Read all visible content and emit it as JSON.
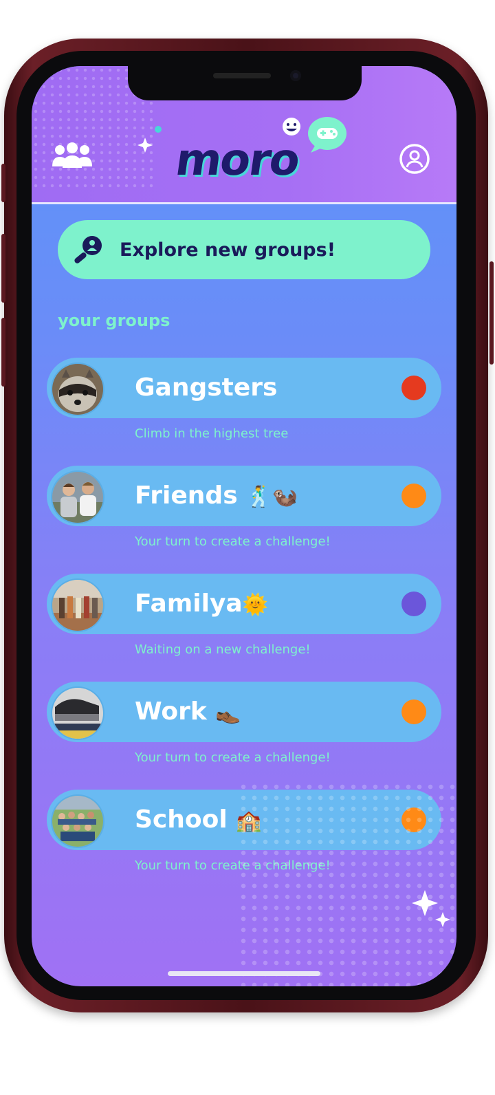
{
  "header": {
    "logo": "moro",
    "groups_icon": "groups-icon",
    "profile_icon": "profile-icon"
  },
  "explore": {
    "label": "Explore new groups!",
    "icon": "search-people-icon"
  },
  "section_label": "your groups",
  "groups": [
    {
      "name": "Gangsters",
      "emoji": "",
      "status": "Climb in the highest tree",
      "dot_color": "#e53a1f"
    },
    {
      "name": "Friends",
      "emoji": "🕺🦦",
      "status": "Your turn to create a challenge!",
      "dot_color": "#ff8a16"
    },
    {
      "name": "Familya",
      "emoji": "🌞",
      "status": "Waiting on a new challenge!",
      "dot_color": "#6b56da"
    },
    {
      "name": "Work",
      "emoji": "👞",
      "status": "Your turn to create a challenge!",
      "dot_color": "#ff8a16"
    },
    {
      "name": "School",
      "emoji": "🏫",
      "status": "Your turn to create a challenge!",
      "dot_color": "#ff8a16"
    }
  ],
  "colors": {
    "accent_mint": "#7ef2cc",
    "row_blue": "#69baf2",
    "header_purple": "#a66ff4"
  }
}
